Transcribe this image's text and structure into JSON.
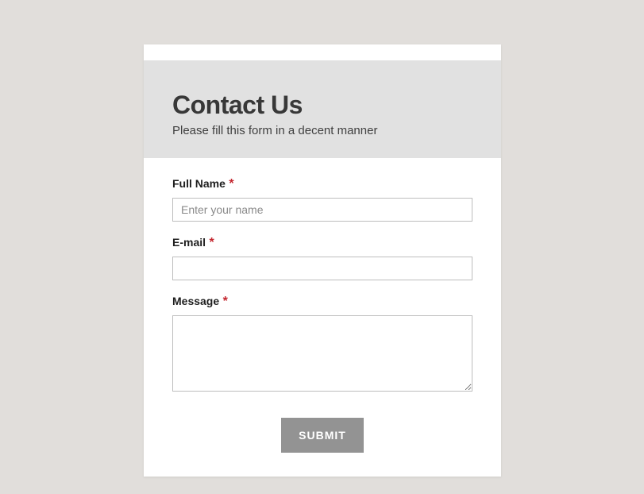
{
  "header": {
    "title": "Contact Us",
    "subtitle": "Please fill this form in a decent manner"
  },
  "form": {
    "fullName": {
      "label": "Full Name",
      "required": "*",
      "placeholder": "Enter your name",
      "value": ""
    },
    "email": {
      "label": "E-mail",
      "required": "*",
      "value": ""
    },
    "message": {
      "label": "Message",
      "required": "*",
      "value": ""
    },
    "submit": {
      "label": "SUBMIT"
    }
  }
}
